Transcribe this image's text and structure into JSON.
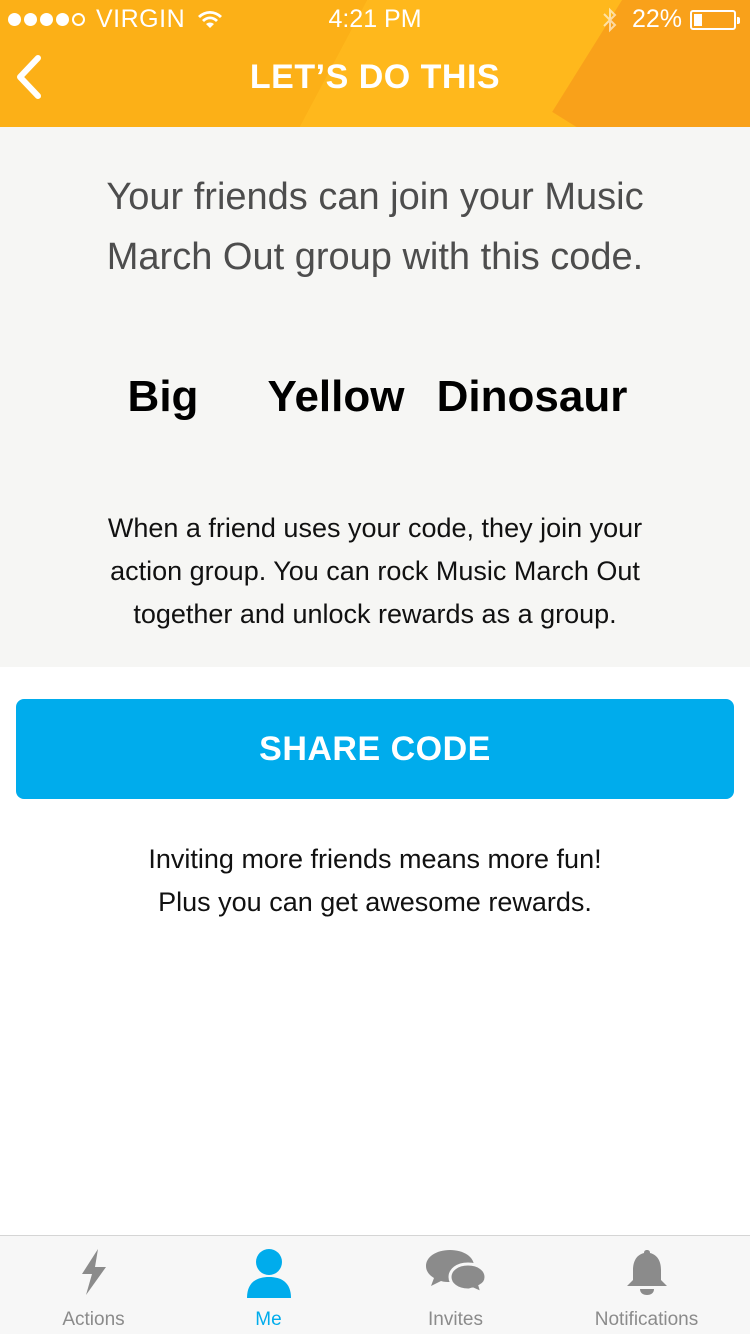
{
  "status_bar": {
    "carrier": "VIRGIN",
    "time": "4:21 PM",
    "battery": "22%"
  },
  "nav": {
    "title": "LET’S DO THIS",
    "back_icon": "chevron-left-icon"
  },
  "panel": {
    "intro": "Your friends can join your Music March Out group with this code.",
    "code_words": [
      "Big",
      "Yellow",
      "Dinosaur"
    ],
    "description": "When a friend uses your code, they join your action group. You can rock Music March Out together and unlock rewards as a group."
  },
  "share_button": {
    "label": "SHARE CODE"
  },
  "invite": {
    "line1": "Inviting more friends means more fun!",
    "line2": "Plus you can get awesome rewards."
  },
  "tabs": [
    {
      "label": "Actions",
      "icon": "lightning-icon",
      "active": false
    },
    {
      "label": "Me",
      "icon": "person-icon",
      "active": true
    },
    {
      "label": "Invites",
      "icon": "chat-bubbles-icon",
      "active": false
    },
    {
      "label": "Notifications",
      "icon": "bell-icon",
      "active": false
    }
  ],
  "colors": {
    "header": "#fcb017",
    "accent": "#00acec",
    "panel_bg": "#f6f6f4",
    "tab_inactive": "#8b8b8b"
  }
}
